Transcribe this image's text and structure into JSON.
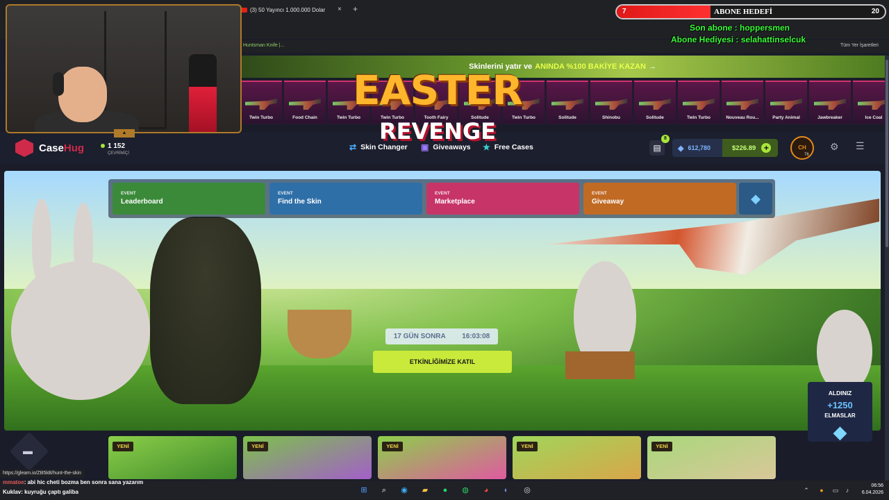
{
  "browser": {
    "tab_title": "(3) 50 Yayıncı 1.000.000 Dolar",
    "tab_close": "×",
    "new_tab": "+",
    "bookmark_left": "Huntsman Knife |...",
    "bookmark_right": "Tüm Yer İşaretleri",
    "status_url": "https://gleam.io/ZB5kB/hunt-the-skin"
  },
  "promo": {
    "text": "Skinlerini yatır ve",
    "highlight": "ANINDA %100 BAKİYE KAZAN",
    "arrow": "→"
  },
  "ticker": {
    "items": [
      "Twin Turbo",
      "Food Chain",
      "Twin Turbo",
      "Twin Turbo",
      "Tooth Fairy",
      "Solitude",
      "Twin Turbo",
      "Solitude",
      "Shinobu",
      "Solitude",
      "Twin Turbo",
      "Nouveau Rou...",
      "Party Animal",
      "Jawbreaker",
      "Ice Coal"
    ]
  },
  "header": {
    "logo_case": "Case",
    "logo_hug": "Hug",
    "online_count": "1 152",
    "online_label": "ÇEVRİMİÇİ",
    "nav": [
      {
        "label": "Skin Changer",
        "icon": "swap-icon"
      },
      {
        "label": "Giveaways",
        "icon": "gift-box-icon"
      },
      {
        "label": "Free Cases",
        "icon": "star-icon"
      }
    ],
    "gift_badge": "8",
    "diamonds": "612,780",
    "balance": "$226.89",
    "level": "76"
  },
  "events": [
    {
      "tag": "EVENT",
      "name": "Leaderboard",
      "color": "#3b8a3a"
    },
    {
      "tag": "EVENT",
      "name": "Find the Skin",
      "color": "#2f6fa8"
    },
    {
      "tag": "EVENT",
      "name": "Marketplace",
      "color": "#c73468"
    },
    {
      "tag": "EVENT",
      "name": "Giveaway",
      "color": "#c06a24"
    }
  ],
  "hero": {
    "title": "EASTER",
    "subtitle": "REVENGE",
    "days": "17 GÜN SONRA",
    "time": "16:03:08",
    "cta": "ETKİNLİĞİMİZE KATIL"
  },
  "reward": {
    "line1": "ALDINIZ",
    "amount": "+1250",
    "line3": "ELMASLAR"
  },
  "cards": {
    "badge": "YENİ"
  },
  "stream": {
    "goal_label": "ABONE HEDEFİ",
    "goal_current": "7",
    "goal_target": "20",
    "goal_progress": 0.35,
    "last_sub": "Son abone : hoppersmen",
    "gift_sub": "Abone Hediyesi : selahattinselcuk",
    "chat": [
      {
        "user": "mmatoe",
        "msg": ": abi hic cheti bozma ben sonra sana yazarım"
      },
      {
        "user": "Kuklav",
        "msg": ": kuyruğu çaptı galiba"
      }
    ]
  },
  "clock": {
    "time": "06:56",
    "date": "6.04.2026"
  }
}
